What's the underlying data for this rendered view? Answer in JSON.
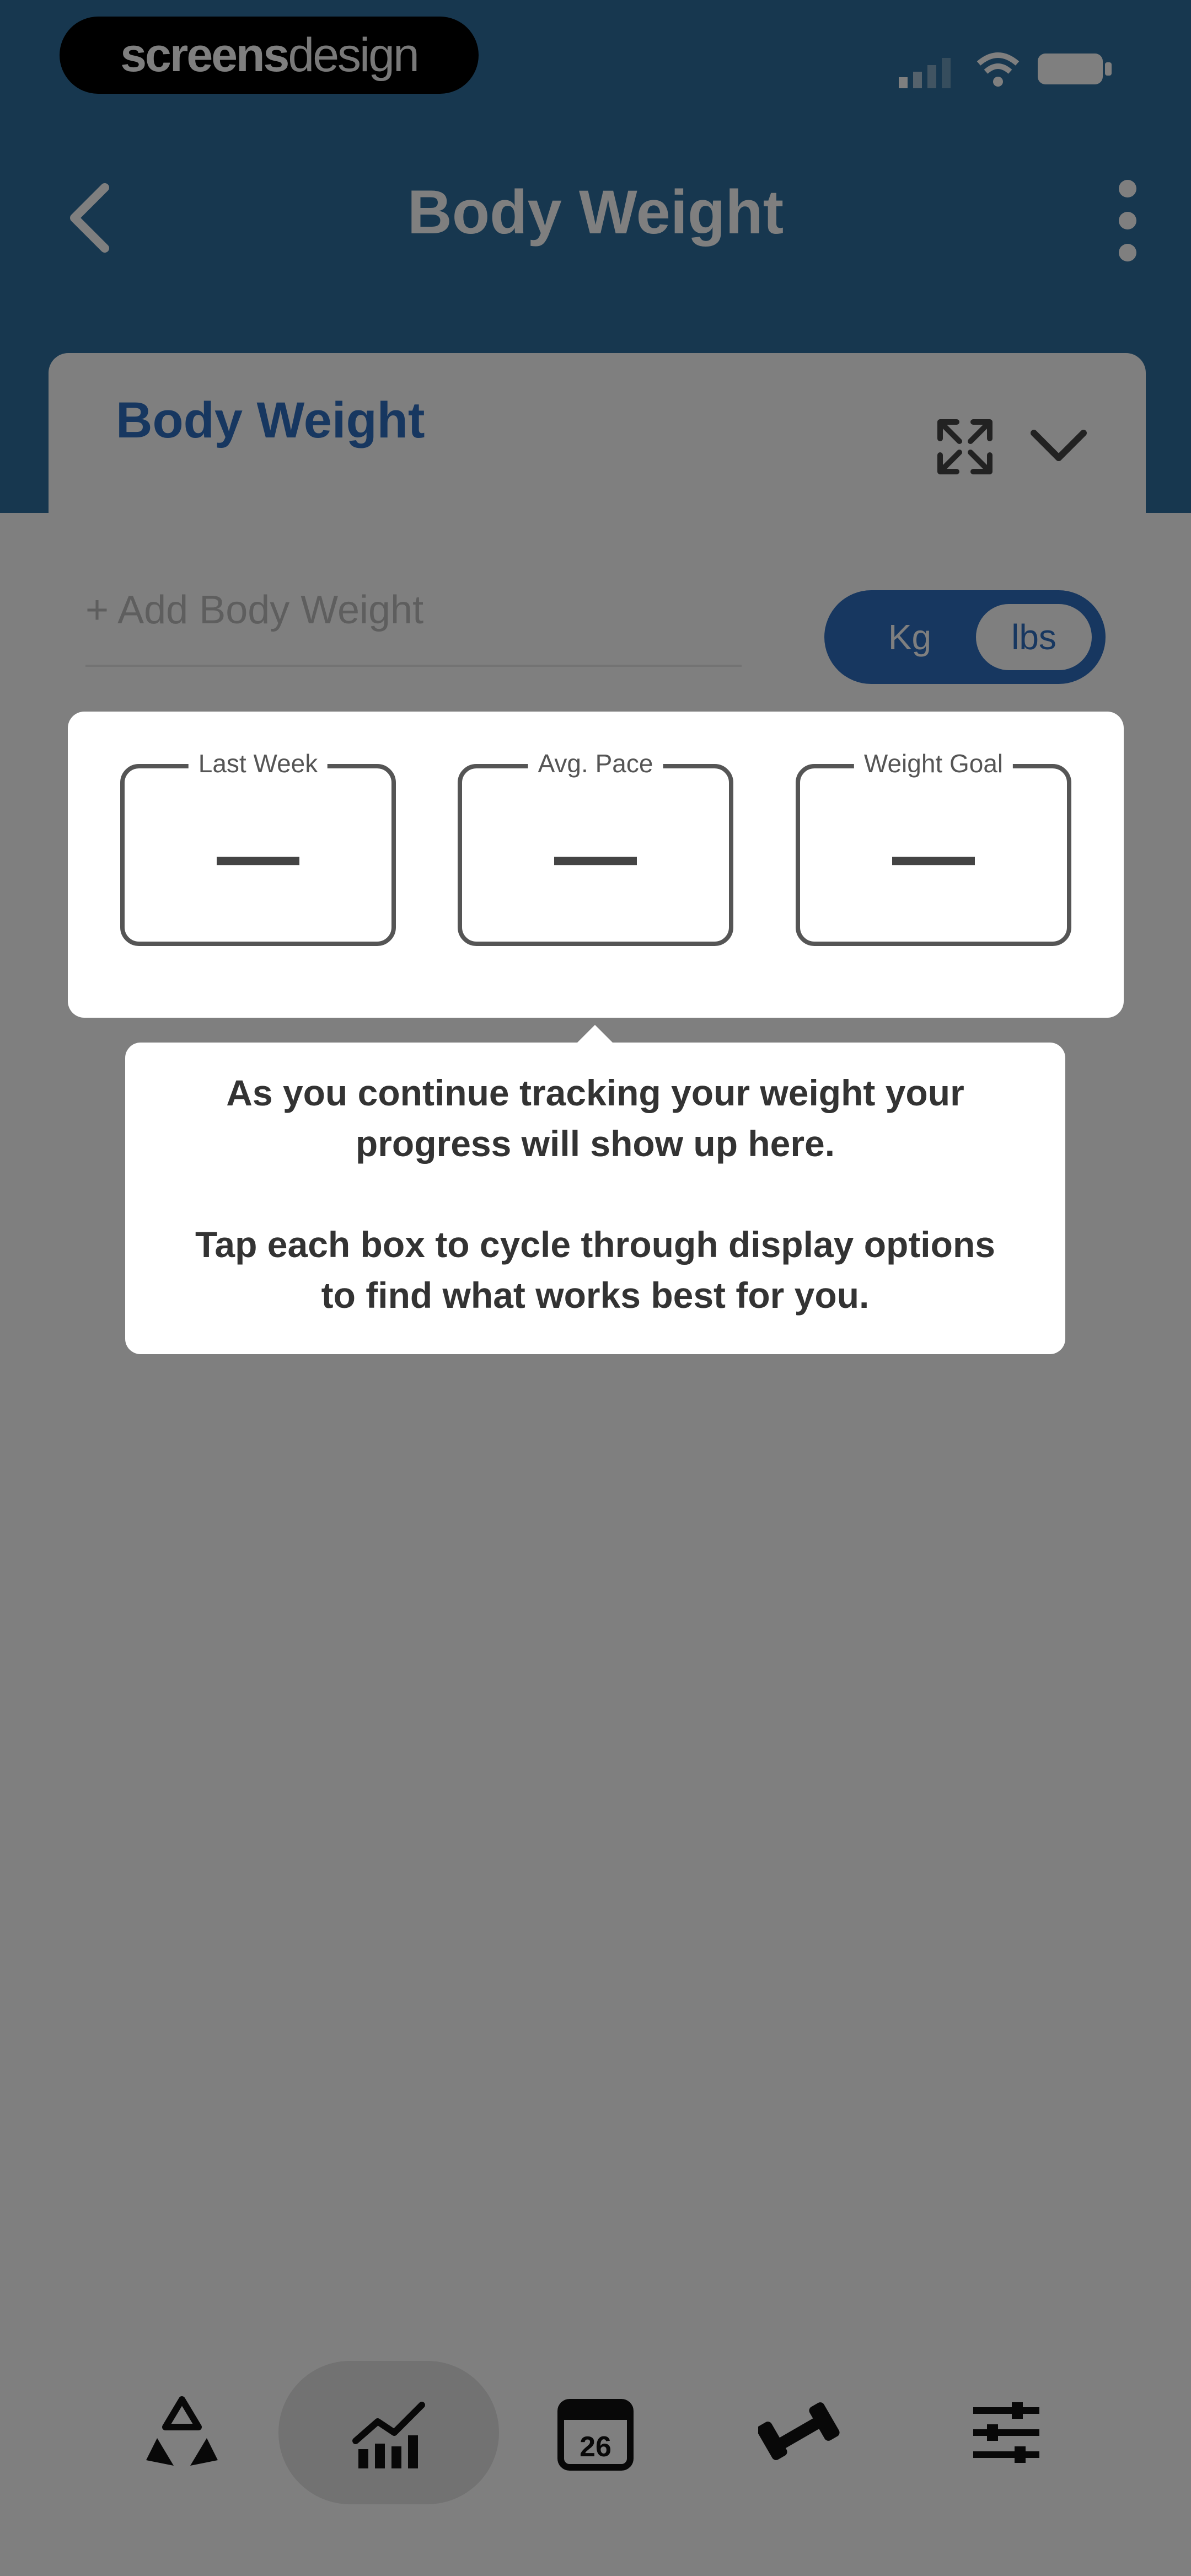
{
  "status_bar": {
    "brand_bold": "screens",
    "brand_light": "design"
  },
  "header": {
    "title": "Body Weight",
    "back_icon": "chevron-left-icon",
    "menu_icon": "kebab-menu-icon",
    "color": "#2f6f9e"
  },
  "card": {
    "title": "Body Weight",
    "add_placeholder": "+ Add Body Weight",
    "unit_toggle": {
      "left": "Kg",
      "right": "lbs",
      "selected": "lbs"
    }
  },
  "stats": [
    {
      "label": "Last Week",
      "value": "—"
    },
    {
      "label": "Avg. Pace",
      "value": "—"
    },
    {
      "label": "Weight Goal",
      "value": "—"
    }
  ],
  "tooltip": {
    "line1": "As you continue tracking your weight your",
    "line2": "progress will show up here.",
    "line3": "Tap each box to cycle through display options",
    "line4": "to find what works best for you."
  },
  "tabbar": {
    "items": [
      {
        "icon": "recycle-icon"
      },
      {
        "icon": "chart-icon",
        "active": true
      },
      {
        "icon": "calendar-icon",
        "label": "26"
      },
      {
        "icon": "dumbbell-icon"
      },
      {
        "icon": "sliders-icon"
      }
    ]
  }
}
